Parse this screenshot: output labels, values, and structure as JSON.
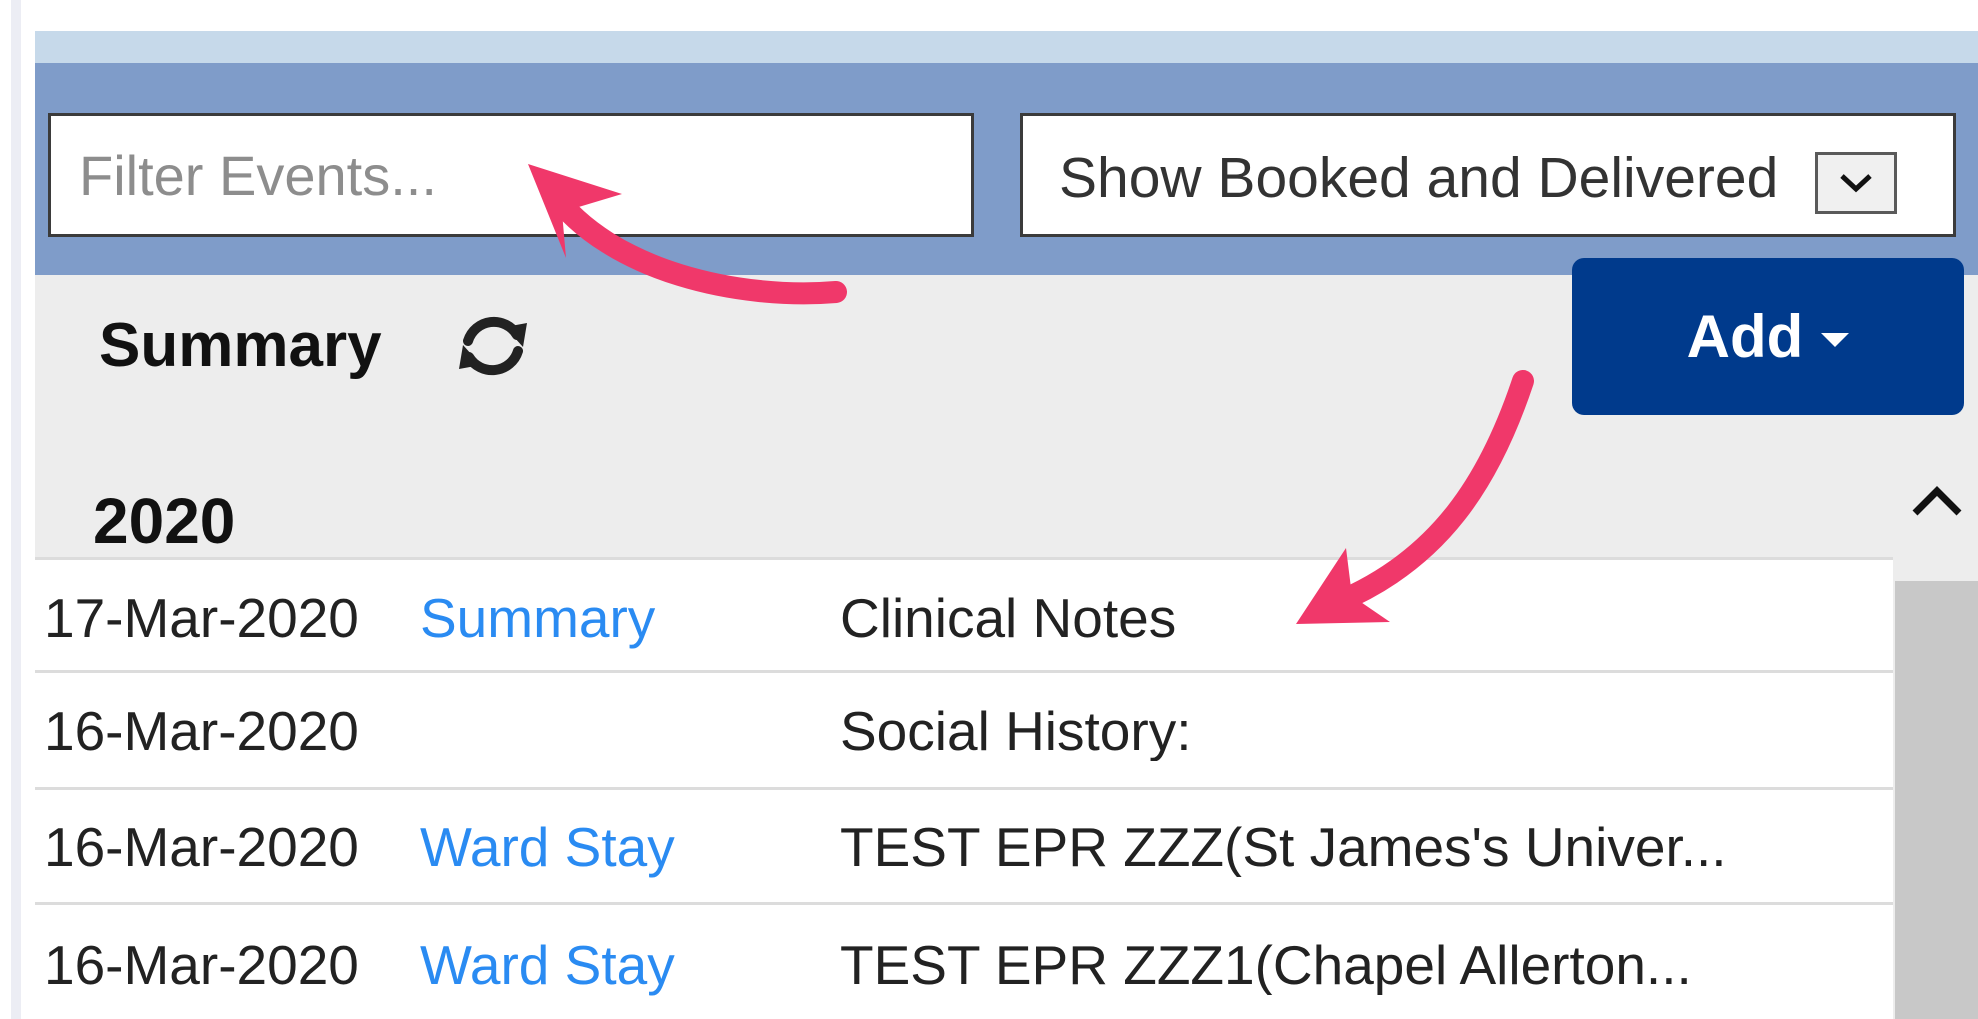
{
  "filter": {
    "placeholder": "Filter Events..."
  },
  "show_select": {
    "selected": "Show Booked and Delivered"
  },
  "summary": {
    "title": "Summary"
  },
  "add_button": {
    "label": "Add"
  },
  "year_group": {
    "label": "2020"
  },
  "events": [
    {
      "date": "17-Mar-2020",
      "type": "Summary",
      "description": "Clinical Notes"
    },
    {
      "date": "16-Mar-2020",
      "type": "",
      "description": "Social History:"
    },
    {
      "date": "16-Mar-2020",
      "type": "Ward Stay",
      "description": "TEST EPR ZZZ(St James's Univer..."
    },
    {
      "date": "16-Mar-2020",
      "type": "Ward Stay",
      "description": "TEST EPR ZZZ1(Chapel Allerton..."
    }
  ],
  "icons": {
    "refresh": "refresh-icon",
    "add_caret": "caret-down-icon",
    "select_caret": "chevron-down-icon",
    "scroll_up": "chevron-up-icon"
  },
  "colors": {
    "filter_bar": "#7f9cc9",
    "add_button": "#003a8c",
    "link": "#2a8bf2",
    "annotation_arrow": "#f0386a"
  }
}
